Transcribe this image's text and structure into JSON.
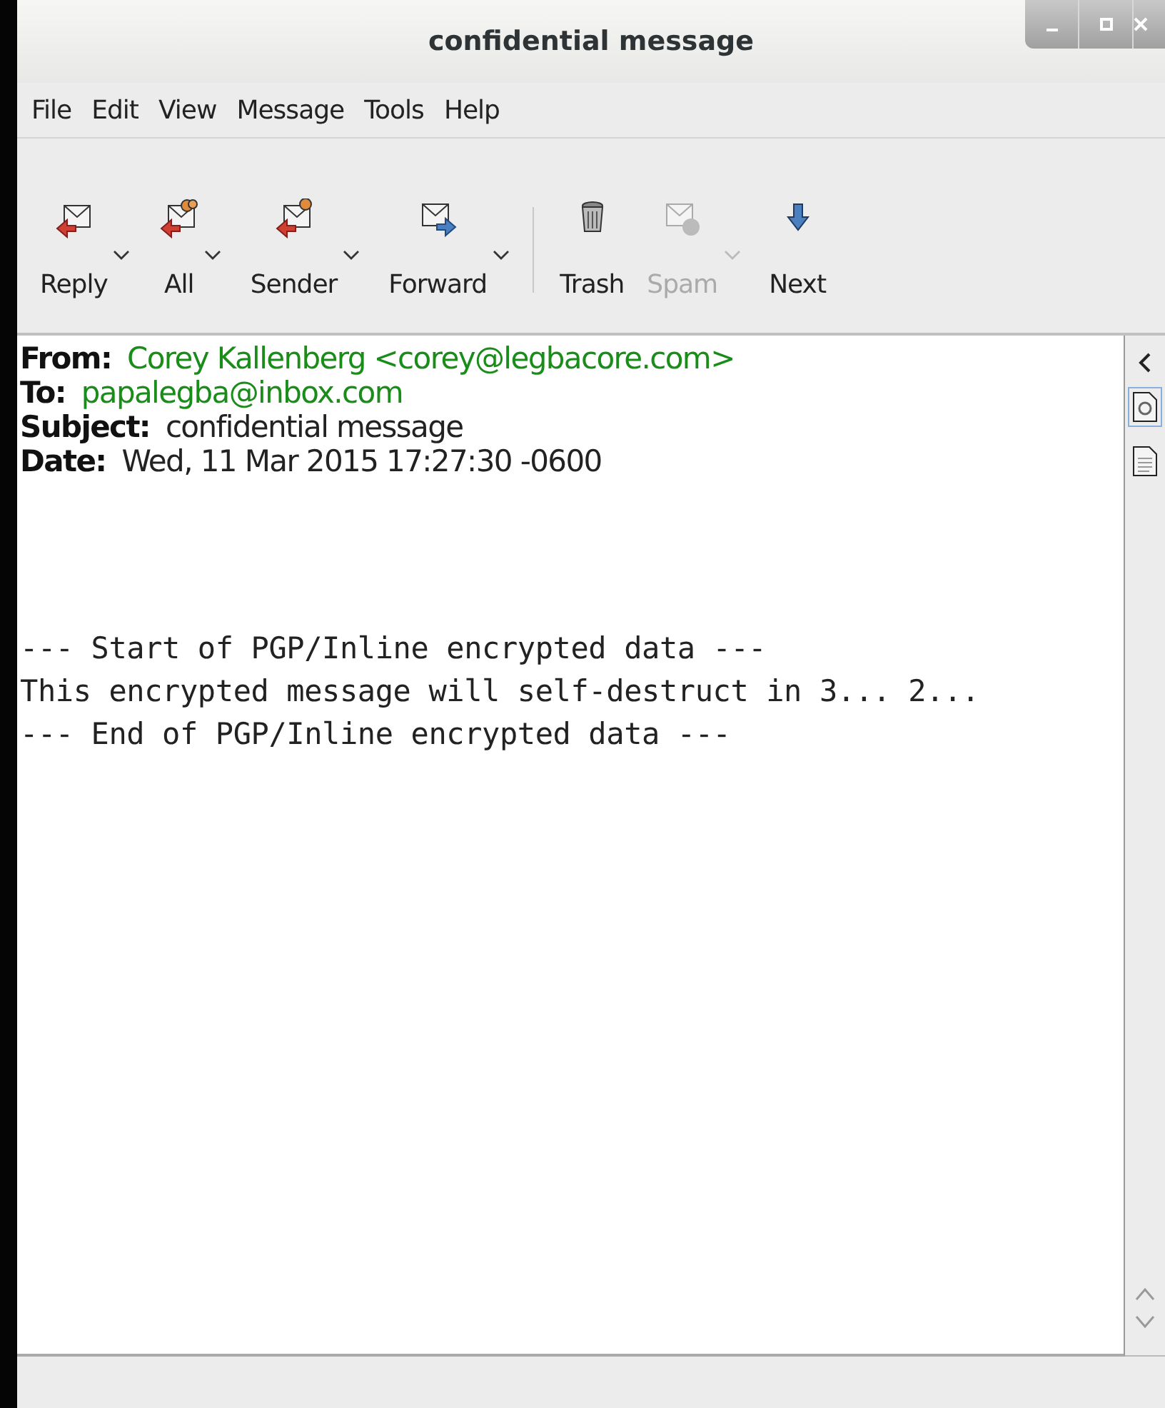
{
  "window": {
    "title": "confidential message"
  },
  "menu": [
    "File",
    "Edit",
    "View",
    "Message",
    "Tools",
    "Help"
  ],
  "toolbar": [
    {
      "kind": "button",
      "label": "Reply",
      "has_menu": true,
      "disabled": false
    },
    {
      "kind": "button",
      "label": "All",
      "has_menu": true,
      "disabled": false
    },
    {
      "kind": "button",
      "label": "Sender",
      "has_menu": true,
      "disabled": false
    },
    {
      "kind": "button",
      "label": "Forward",
      "has_menu": true,
      "disabled": false
    },
    {
      "kind": "separator"
    },
    {
      "kind": "button",
      "label": "Trash",
      "has_menu": false,
      "disabled": false
    },
    {
      "kind": "button",
      "label": "Spam",
      "has_menu": true,
      "disabled": true
    },
    {
      "kind": "button",
      "label": "Next",
      "has_menu": false,
      "disabled": false
    }
  ],
  "headers": [
    {
      "label": "From:",
      "value": "Corey Kallenberg <corey@legbacore.com>",
      "kind": "address"
    },
    {
      "label": "To:",
      "value": "papalegba@inbox.com",
      "kind": "address"
    },
    {
      "label": "Subject:",
      "value": "confidential message",
      "kind": "text"
    },
    {
      "label": "Date:",
      "value": "Wed, 11 Mar 2015 17:27:30 -0600",
      "kind": "text"
    }
  ],
  "body": [
    "--- Start of PGP/Inline encrypted data ---",
    "This encrypted message will self-destruct in 3... 2...",
    "--- End of PGP/Inline encrypted data ---"
  ],
  "side_panel": [
    {
      "selected": true
    },
    {
      "selected": false
    }
  ]
}
